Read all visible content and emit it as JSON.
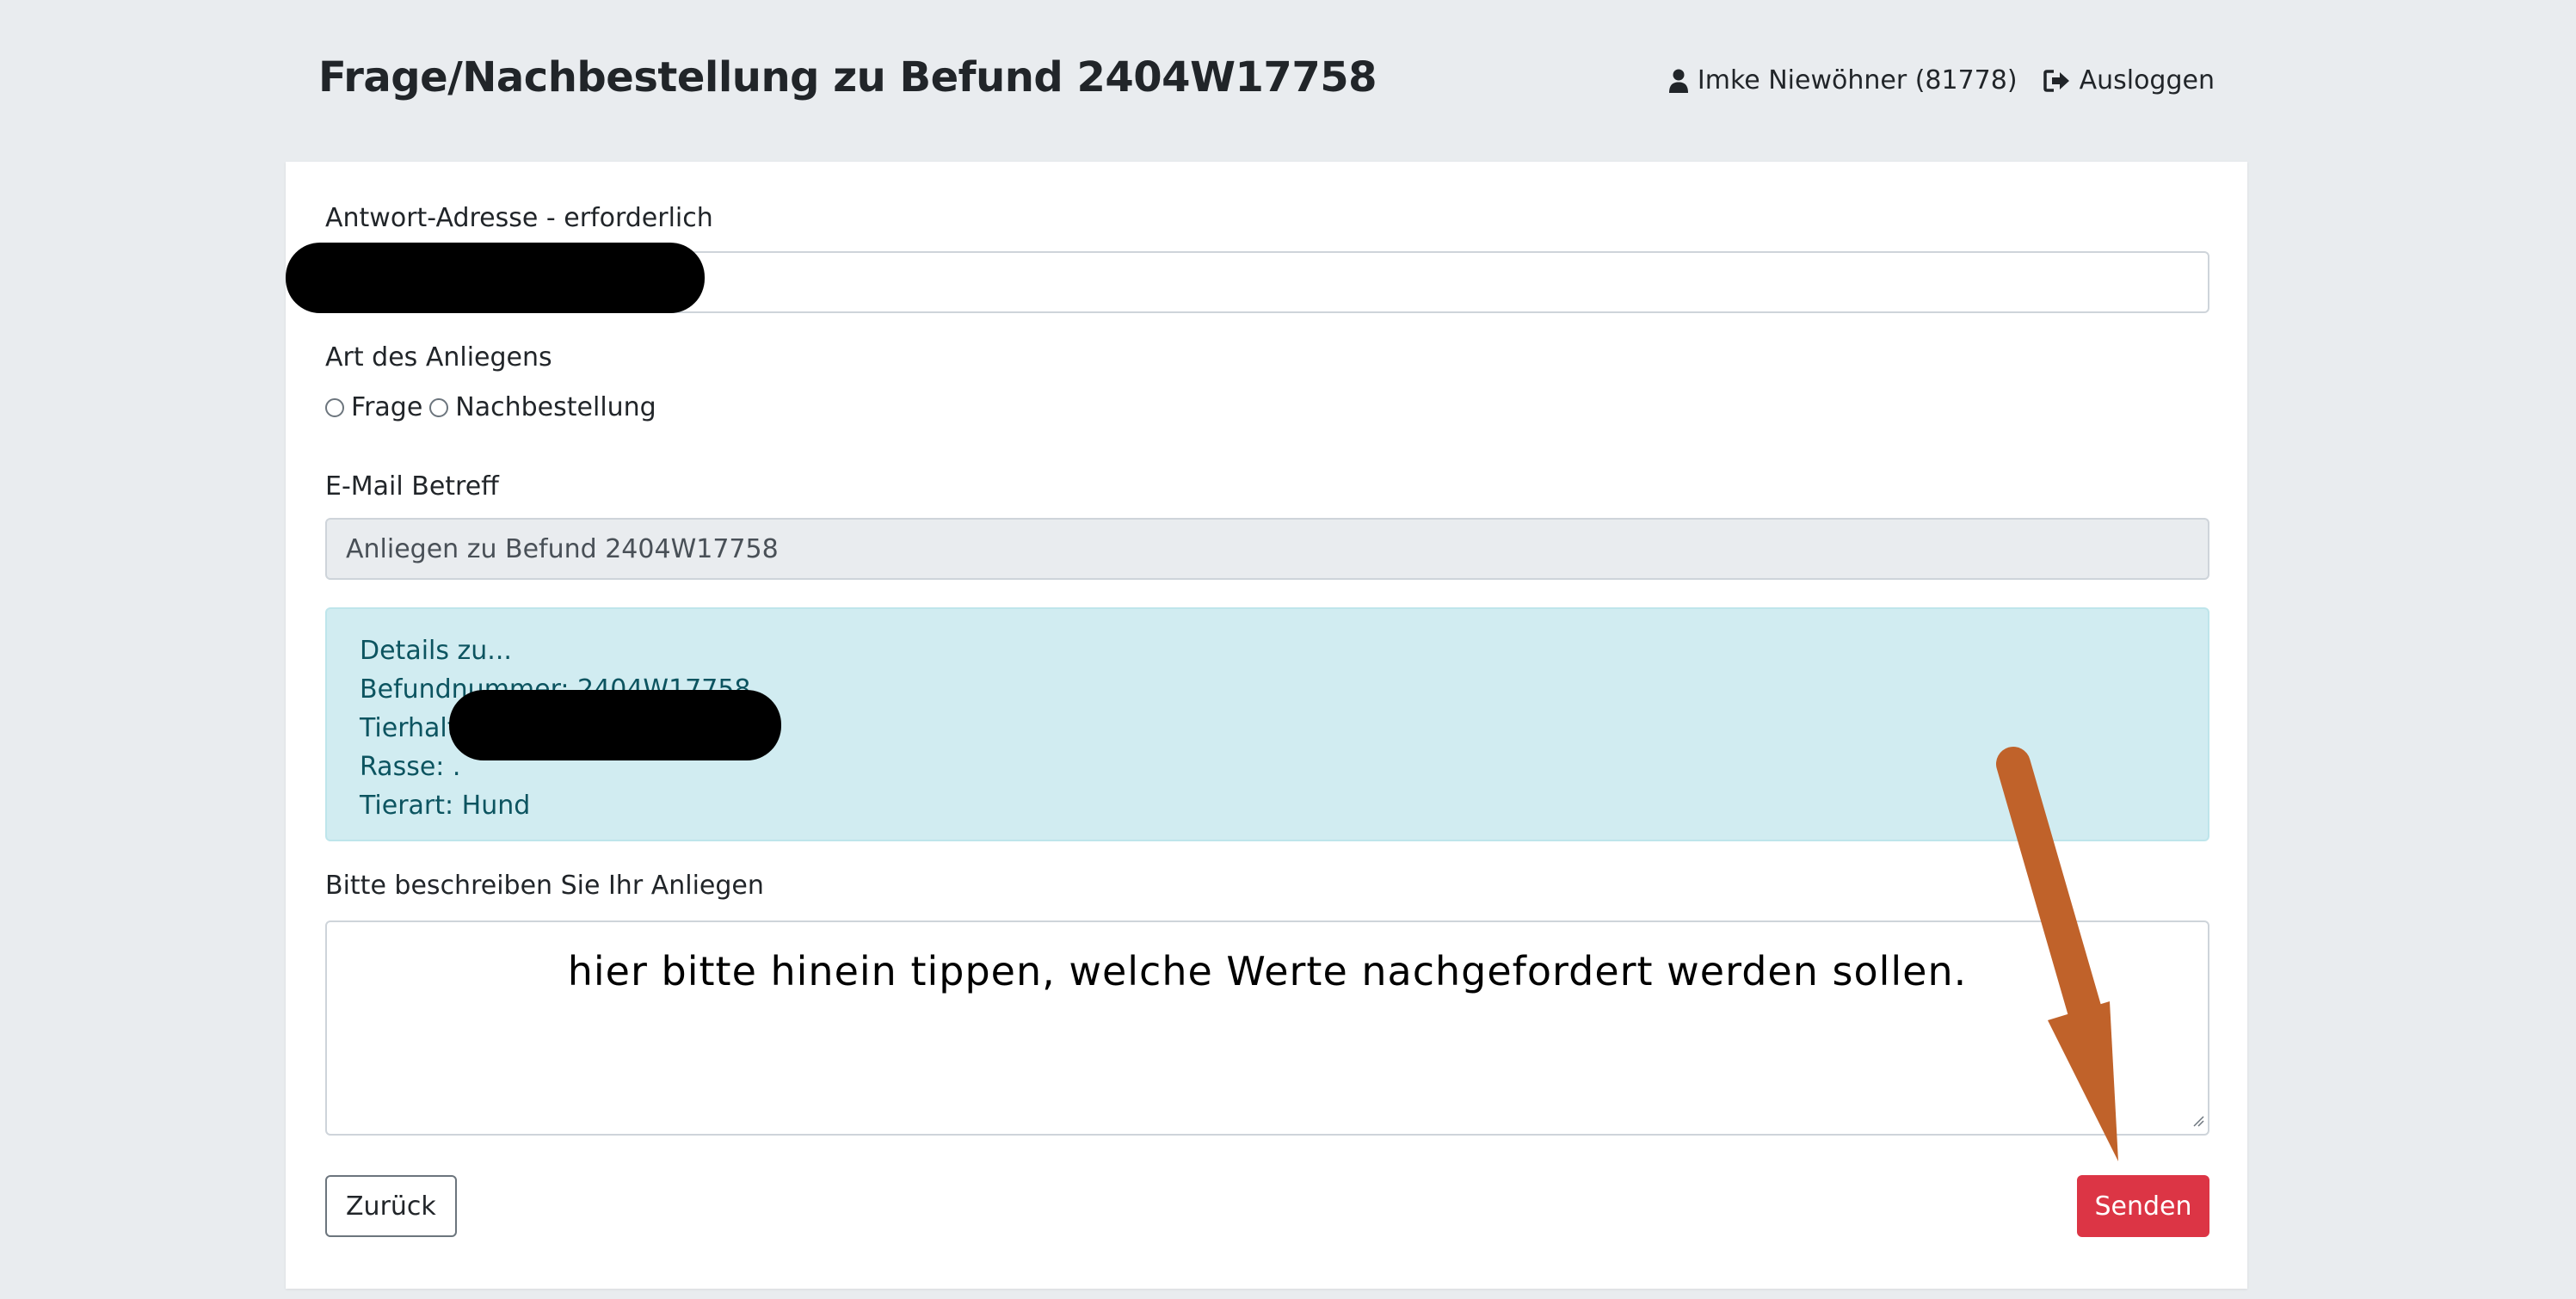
{
  "header": {
    "title": "Frage/Nachbestellung zu Befund 2404W17758",
    "user_label": "Imke Niewöhner (81778)",
    "logout_label": "Ausloggen"
  },
  "form": {
    "reply_address": {
      "label": "Antwort-Adresse - erforderlich",
      "value": ""
    },
    "request_type": {
      "label": "Art des Anliegens",
      "options": [
        "Frage",
        "Nachbestellung"
      ],
      "selected": null
    },
    "subject": {
      "label": "E-Mail Betreff",
      "value": "Anliegen zu Befund 2404W17758"
    },
    "details": {
      "lines": [
        "Details zu...",
        "Befundnummer: 2404W17758",
        "Tierhalt",
        "Rasse: .",
        "Tierart: Hund"
      ]
    },
    "message": {
      "label": "Bitte beschreiben Sie Ihr Anliegen",
      "value": "hier bitte hinein tippen, welche Werte nachgefordert werden sollen."
    },
    "buttons": {
      "back_label": "Zurück",
      "send_label": "Senden"
    }
  },
  "colors": {
    "page_background": "#e9ecef",
    "card_background": "#ffffff",
    "info_background": "#d1ecf1",
    "info_text": "#0c5460",
    "send_button": "#dc3545",
    "annotation_arrow": "#c0622a",
    "redaction": "#000000"
  },
  "icons": {
    "user": "user-icon",
    "logout": "sign-out-icon"
  }
}
